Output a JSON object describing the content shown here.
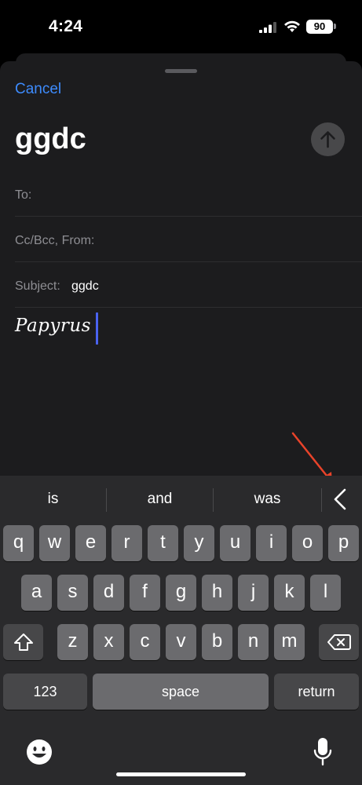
{
  "status_bar": {
    "time": "4:24",
    "battery": "90"
  },
  "compose": {
    "cancel_label": "Cancel",
    "title": "ggdc",
    "to_label": "To:",
    "cc_label": "Cc/Bcc, From:",
    "subject_label": "Subject:",
    "subject_value": "ggdc",
    "body_text": "Papyrus"
  },
  "keyboard": {
    "suggestions": [
      "is",
      "and",
      "was"
    ],
    "row1": [
      "q",
      "w",
      "e",
      "r",
      "t",
      "y",
      "u",
      "i",
      "o",
      "p"
    ],
    "row2": [
      "a",
      "s",
      "d",
      "f",
      "g",
      "h",
      "j",
      "k",
      "l"
    ],
    "row3": [
      "z",
      "x",
      "c",
      "v",
      "b",
      "n",
      "m"
    ],
    "numbers_label": "123",
    "space_label": "space",
    "return_label": "return"
  },
  "icons": {
    "send": "arrow-up-icon",
    "collapse": "chevron-left-icon",
    "shift": "shift-icon",
    "delete": "delete-backward-icon",
    "emoji": "emoji-icon",
    "mic": "microphone-icon"
  },
  "colors": {
    "accent": "#3d8bfd",
    "cursor": "#4a63f0",
    "annotation": "#e8432a"
  }
}
